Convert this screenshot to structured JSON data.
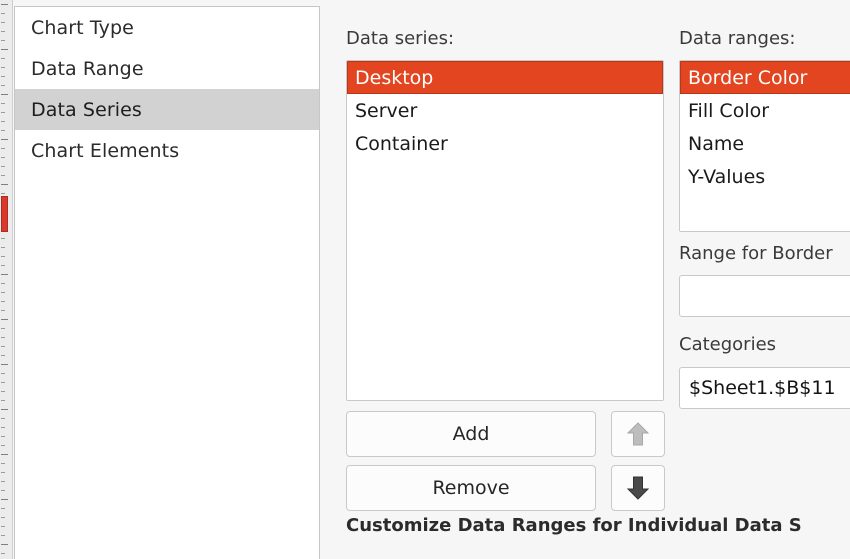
{
  "ruler": {
    "name": "vertical-ruler",
    "marker_color": "#d9392a"
  },
  "sidebar": {
    "items": [
      {
        "label": "Chart Type",
        "selected": false
      },
      {
        "label": "Data Range",
        "selected": false
      },
      {
        "label": "Data Series",
        "selected": true
      },
      {
        "label": "Chart Elements",
        "selected": false
      }
    ]
  },
  "data_series": {
    "label": "Data series:",
    "items": [
      {
        "label": "Desktop",
        "selected": true
      },
      {
        "label": "Server",
        "selected": false
      },
      {
        "label": "Container",
        "selected": false
      }
    ],
    "add_label": "Add",
    "remove_label": "Remove",
    "move_up_icon": "arrow-up-icon",
    "move_down_icon": "arrow-down-icon"
  },
  "data_ranges": {
    "label": "Data ranges:",
    "items": [
      {
        "label": "Border Color",
        "selected": true
      },
      {
        "label": "Fill Color",
        "selected": false
      },
      {
        "label": "Name",
        "selected": false
      },
      {
        "label": "Y-Values",
        "selected": false
      }
    ],
    "range_for_label": "Range for Border",
    "range_for_value": "",
    "categories_label": "Categories",
    "categories_value": "$Sheet1.$B$11"
  },
  "footer": {
    "note": "Customize Data Ranges for Individual Data S"
  },
  "colors": {
    "selection_orange": "#e2451f",
    "sidebar_selection_gray": "#d2d2d2",
    "page_background": "#f6f6f6"
  }
}
